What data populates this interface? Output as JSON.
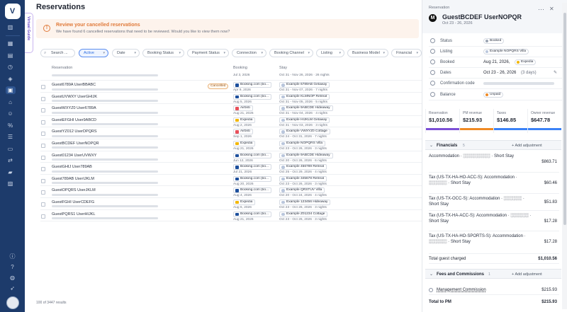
{
  "nav": {
    "logo": "V",
    "icons": [
      "menu-icon",
      "dashboard-icon",
      "document-icon",
      "clock-icon",
      "tag-icon",
      "calendar-icon",
      "home-icon",
      "person-icon",
      "percent-icon",
      "list-icon",
      "clipboard-icon",
      "flow-icon",
      "folder-icon",
      "chart-icon"
    ],
    "bottom_icons": [
      "info-icon",
      "help-icon",
      "globe-icon",
      "rocket-icon"
    ]
  },
  "virtual_guide": "Virtual Guide",
  "page_title": "Reservations",
  "banner": {
    "title": "Review your cancelled reservations",
    "subtitle": "We have found 6 cancelled reservations that need to be reviewed. Would you like to view them now?"
  },
  "filters": {
    "search_placeholder": "Search ...",
    "active": "Active",
    "date": "Date",
    "booking_status": "Booking Status",
    "payment_status": "Payment Status",
    "connection": "Connection",
    "booking_channel": "Booking Channel",
    "listing": "Listing",
    "business_model": "Business Model",
    "financial": "Financial"
  },
  "columns": {
    "reservation": "Reservation",
    "booking": "Booking",
    "stay": "Stay"
  },
  "first_row": {
    "booking_date": "Jul 3, 2026",
    "stay_dates": "Oct 31 - Nov 26, 2026 · 26 nights"
  },
  "rows": [
    {
      "guest": "Guest6789A UserBBABC",
      "tag": "Cancelled",
      "channel": "Booking.com (bo...",
      "ch_color": "#1d4f9c",
      "booked": "Apr 9, 2026",
      "listing": "Example 6789AB Getaway",
      "stay": "Oct 31 - Nov 07, 2026 · 7 nights"
    },
    {
      "guest": "GuestUVWXY UserGHIJK",
      "tag": "",
      "channel": "Booking.com (bo...",
      "ch_color": "#1d4f9c",
      "booked": "Aug 5, 2026",
      "listing": "Example KLMNOP Retreat",
      "stay": "Oct 31 - Nov 05, 2026 · 5 nights"
    },
    {
      "guest": "GuestWXYZ0 User6789A",
      "tag": "",
      "channel": "Airbnb",
      "ch_color": "#e8505b",
      "booked": "Aug 21, 2026",
      "listing": "Example 9ABCDE Hideaway",
      "stay": "Oct 31 - Nov 04, 2026 · 4 nights"
    },
    {
      "guest": "GuestEFGHI User9ABCD",
      "tag": "",
      "channel": "Expedia",
      "ch_color": "#f2b705",
      "booked": "Aug 2, 2026",
      "listing": "Example HIJKLM Getaway",
      "stay": "Oct 31 - Nov 03, 2026 · 3 nights"
    },
    {
      "guest": "GuestYZ012 UserDPQRS",
      "tag": "",
      "channel": "Airbnb",
      "ch_color": "#e8505b",
      "booked": "Sep 1, 2026",
      "listing": "Example VWXYZ0 Cottage",
      "stay": "Oct 24 - Oct 31, 2026 · 7 nights"
    },
    {
      "guest": "GuestBCDEF UserNOPQR",
      "tag": "",
      "channel": "Expedia",
      "ch_color": "#f2b705",
      "booked": "Aug 21, 2026",
      "listing": "Example NOPQRS Villa",
      "stay": "Oct 23 - Oct 26, 2026 · 3 nights"
    },
    {
      "guest": "Guest01234 UserUVWXY",
      "tag": "",
      "channel": "Booking.com (bo...",
      "ch_color": "#1d4f9c",
      "booked": "Jun 12, 2026",
      "listing": "Example 9ABCDE Hideaway",
      "stay": "Oct 20 - Oct 26, 2026 · 6 nights"
    },
    {
      "guest": "GuestGHIJ User789AB",
      "tag": "",
      "channel": "Booking.com (bo...",
      "ch_color": "#1d4f9c",
      "booked": "Jul 21, 2026",
      "listing": "Example 456789 Retreat",
      "stay": "Oct 25 - Oct 29, 2026 · 4 nights"
    },
    {
      "guest": "Guest789AB UserIJKLM",
      "tag": "",
      "channel": "Booking.com (bo...",
      "ch_color": "#1d4f9c",
      "booked": "Aug 20, 2026",
      "listing": "Example 345678 Retreat",
      "stay": "Oct 23 - Oct 26, 2026 · 3 nights"
    },
    {
      "guest": "GuestOPQRS UserJKLM",
      "tag": "",
      "channel": "Booking.com (bo...",
      "ch_color": "#1d4f9c",
      "booked": "Aug 4, 2026",
      "listing": "Example QRSTUV Villa",
      "stay": "Oct 20 - Oct 24, 2026 · 4 nights"
    },
    {
      "guest": "GuestFGHI UserCDEFG",
      "tag": "",
      "channel": "Expedia",
      "ch_color": "#f2b705",
      "booked": "Aug 6, 2026",
      "listing": "Example 123456 Hideaway",
      "stay": "Oct 23 - Oct 26, 2026 · 3 nights"
    },
    {
      "guest": "GuestPQRS1 UserHIJKL",
      "tag": "",
      "channel": "Booking.com (bo...",
      "ch_color": "#1d4f9c",
      "booked": "Aug 21, 2026",
      "listing": "Example Z01234 Cottage",
      "stay": "Oct 23 - Oct 26, 2026 · 3 nights"
    }
  ],
  "footer": "100 of 3447 results",
  "panel": {
    "kicker": "Reservation",
    "guest": "GuestBCDEF UserNOPQR",
    "dates": "Oct 23 - 26, 2026",
    "mark": "M",
    "status_label": "Status",
    "status_value": "Booked",
    "listing_label": "Listing",
    "listing_value": "Example NOPQRS Villa",
    "booked_label": "Booked",
    "booked_value": "Aug 21, 2026,",
    "booked_channel": "Expedia",
    "dates_label": "Dates",
    "dates_value": "Oct 23 - 26, 2026",
    "dates_nights": "(3 days)",
    "confirmation_label": "Confirmation code",
    "balance_label": "Balance",
    "balance_value": "Unpaid",
    "stats": [
      {
        "label": "Reservation",
        "value": "$1,010.56",
        "color": "#7b4fd6"
      },
      {
        "label": "PM revenue",
        "value": "$215.93",
        "color": "#f08a24"
      },
      {
        "label": "Taxes",
        "value": "$146.85",
        "color": "#3b82f6"
      },
      {
        "label": "Owner revenue",
        "value": "$647.78",
        "color": "#3b82f6"
      }
    ],
    "financials_title": "Financials",
    "financials_count": "5",
    "add_adjustment": "Add adjustment",
    "items": [
      {
        "label": "Accommodation · ░░░░░░░░░ · Short Stay",
        "value": "$863.71"
      },
      {
        "label": "Tax (US-TX-HA-HO-ACC-S): Accommodation · ░░░░░░ · Short Stay",
        "value": "$60.46"
      },
      {
        "label": "Tax (US-TX-OCC-S): Accommodation · ░░░░░░ · Short Stay",
        "value": "$51.83"
      },
      {
        "label": "Tax (US-TX-HA-ACC-S): Accommodation · ░░░░░░ · Short Stay",
        "value": "$17.28"
      },
      {
        "label": "Tax (US-TX-HA-HO-SPORTS-S): Accommodation · ░░░░░░ · Short Stay",
        "value": "$17.28"
      }
    ],
    "total_charged_label": "Total guest charged",
    "total_charged_value": "$1,010.56",
    "fees_title": "Fees and Commissions",
    "fees_count": "1",
    "mgmt_label": "Management Commission",
    "mgmt_value": "$215.93",
    "total_pm_label": "Total to PM",
    "total_pm_value": "$215.93"
  }
}
